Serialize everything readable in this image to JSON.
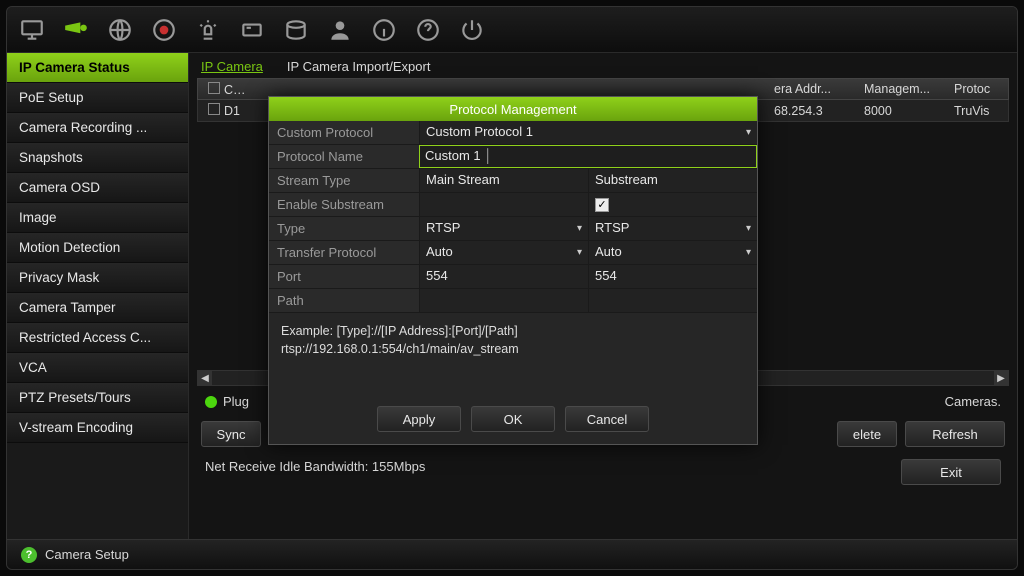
{
  "topbar": {
    "icons": [
      "monitor",
      "camera",
      "globe",
      "record",
      "alarm",
      "badge",
      "hdd",
      "user",
      "info",
      "help",
      "power"
    ]
  },
  "sidebar": {
    "items": [
      "IP Camera Status",
      "PoE Setup",
      "Camera Recording ...",
      "Snapshots",
      "Camera OSD",
      "Image",
      "Motion Detection",
      "Privacy Mask",
      "Camera Tamper",
      "Restricted Access C...",
      "VCA",
      "PTZ Presets/Tours",
      "V-stream Encoding"
    ],
    "active_index": 0
  },
  "tabs": {
    "items": [
      "IP Camera",
      "IP Camera Import/Export"
    ],
    "active_index": 0
  },
  "table": {
    "headers": [
      "Came",
      "",
      "",
      "era Addr...",
      "Managem...",
      "Protoc"
    ],
    "row": {
      "id": "D1",
      "addr": "68.254.3",
      "port": "8000",
      "proto": "TruVis"
    }
  },
  "status": {
    "plug_prefix": "Plug",
    "plug_suffix": "Cameras."
  },
  "buttons": {
    "sync": "Sync",
    "delete": "elete",
    "refresh": "Refresh",
    "exit": "Exit"
  },
  "bandwidth": "Net Receive Idle Bandwidth: 155Mbps",
  "footer": "Camera Setup",
  "modal": {
    "title": "Protocol Management",
    "fields": {
      "custom_protocol_label": "Custom Protocol",
      "custom_protocol_value": "Custom Protocol 1",
      "protocol_name_label": "Protocol Name",
      "protocol_name_value": "Custom 1",
      "stream_type_label": "Stream Type",
      "stream_main": "Main Stream",
      "stream_sub": "Substream",
      "enable_sub_label": "Enable Substream",
      "enable_sub_checked": true,
      "type_label": "Type",
      "type_main": "RTSP",
      "type_sub": "RTSP",
      "transfer_label": "Transfer Protocol",
      "transfer_main": "Auto",
      "transfer_sub": "Auto",
      "port_label": "Port",
      "port_main": "554",
      "port_sub": "554",
      "path_label": "Path",
      "path_main": "",
      "path_sub": ""
    },
    "example_line1": "Example: [Type]://[IP Address]:[Port]/[Path]",
    "example_line2": "rtsp://192.168.0.1:554/ch1/main/av_stream",
    "buttons": {
      "apply": "Apply",
      "ok": "OK",
      "cancel": "Cancel"
    }
  }
}
